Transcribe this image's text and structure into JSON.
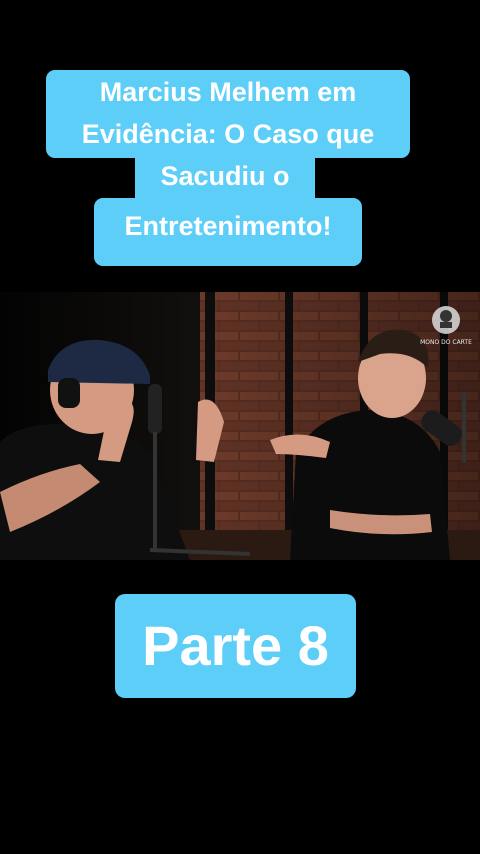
{
  "caption": {
    "lines": [
      "Marcius Melhem em",
      "Evidência: O Caso que",
      "Sacudiu o",
      "Entretenimento!"
    ]
  },
  "video": {
    "watermark_text": "MONO DO CARTE"
  },
  "part_label": "Parte 8",
  "colors": {
    "caption_bg": "#5ccef8",
    "caption_text": "#ffffff",
    "page_bg": "#000000"
  }
}
